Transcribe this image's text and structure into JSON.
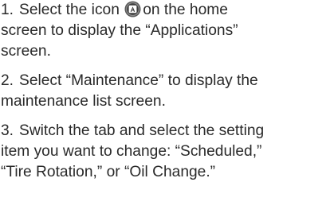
{
  "steps": [
    {
      "number": "1.",
      "line1_before_icon": "Select the icon",
      "line1_after_icon": "on the home",
      "line2": "screen to display the “Applications”",
      "line3": "screen.",
      "icon": "applications-icon"
    },
    {
      "number": "2.",
      "line1": "Select “Maintenance” to display the",
      "line2": "maintenance list screen."
    },
    {
      "number": "3.",
      "line1": "Switch the tab and select the setting",
      "line2": "item you want to change: “Scheduled,”",
      "line3": "“Tire Rotation,” or “Oil Change.”"
    }
  ],
  "colors": {
    "text": "#2a2a2a",
    "icon_ring": "#3c3c3c",
    "icon_fill": "#5a5a5a"
  }
}
